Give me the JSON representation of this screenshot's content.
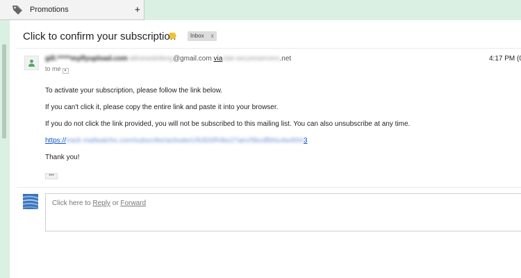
{
  "tabs": [
    {
      "label": "Promotions",
      "icon": "tag-icon"
    }
  ],
  "add_tab_label": "+",
  "email": {
    "subject": "Click to confirm your subscription",
    "label_color": "#f1c232",
    "inbox_chip": {
      "label": "Inbox",
      "close": "x"
    },
    "sender": {
      "name": "gill.*****mylfyupload.com",
      "email_local": "attnewsletterg",
      "email_domain": "@gmail.com",
      "via_label": "via",
      "via_domain_blurred": "ctat-secureservers",
      "via_domain_tld": ".net"
    },
    "time": "4:17 PM (0",
    "recipient": "to me",
    "body": {
      "line1": "To activate your subscription, please follow the link below.",
      "line2": "If you can't click it, please copy the entire link and paste it into your browser.",
      "line3": "If you do not click the link provided, you will not be subscribed to this mailing list. You can also unsubscribe at any time.",
      "link_prefix": "https://",
      "link_blurred": "track.mailwatchs.com/subscribe/activate/c/b3D0R4ke27aev/5bcdfbhiu4w4hh8mt1clubmain72kbjvsz",
      "link_suffix": "3",
      "closing": "Thank you!"
    },
    "ellipsis": "•••"
  },
  "reply": {
    "prefix": "Click here to ",
    "reply_link": "Reply",
    "middle": " or ",
    "forward_link": "Forward"
  }
}
